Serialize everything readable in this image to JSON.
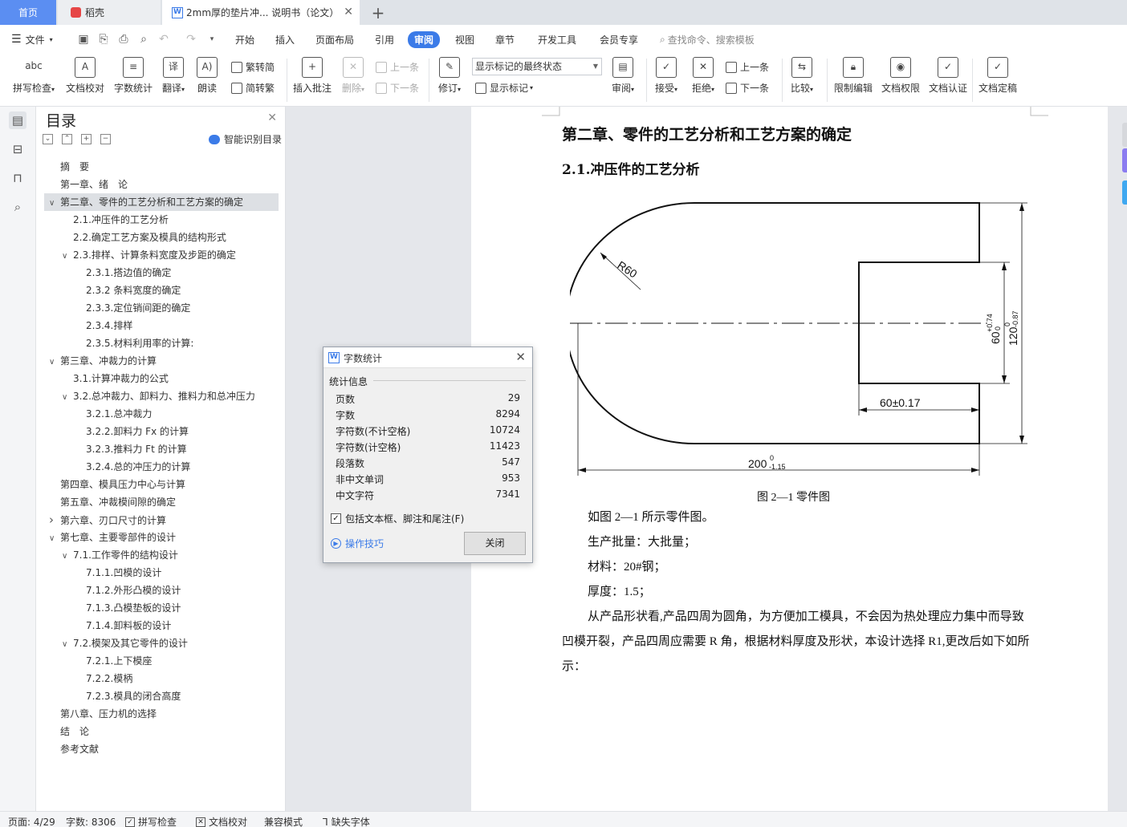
{
  "tabs": {
    "home": "首页",
    "daoke": "稻壳",
    "doc": "2mm厚的垫片冲... 说明书（论文）"
  },
  "menu": {
    "file": "文件",
    "items": [
      "开始",
      "插入",
      "页面布局",
      "引用",
      "审阅",
      "视图",
      "章节",
      "开发工具",
      "会员专享"
    ],
    "active": "审阅",
    "search_placeholder": "查找命令、搜索模板"
  },
  "ribbon": {
    "spell_check": "拼写检查",
    "doc_proof": "文档校对",
    "word_count": "字数统计",
    "translate": "翻译",
    "read_aloud": "朗读",
    "trad_to_simp_1": "繁转简",
    "simp_to_trad": "简转繁",
    "insert_comment": "插入批注",
    "delete": "删除",
    "prev_comment": "上一条",
    "next_comment": "下一条",
    "track_changes": "修订",
    "markup_combo": "显示标记的最终状态",
    "show_markup": "显示标记",
    "review": "审阅",
    "accept": "接受",
    "reject": "拒绝",
    "prev": "上一条",
    "next": "下一条",
    "compare": "比较",
    "restrict_edit": "限制编辑",
    "doc_rights": "文档权限",
    "doc_cert": "文档认证",
    "doc_final": "文档定稿"
  },
  "nav": {
    "title": "目录",
    "smart_toc": "智能识别目录",
    "items": [
      {
        "label": "摘　要",
        "level": 0,
        "caret": ""
      },
      {
        "label": "第一章、绪　论",
        "level": 0,
        "caret": ""
      },
      {
        "label": "第二章、零件的工艺分析和工艺方案的确定",
        "level": 0,
        "caret": "v"
      },
      {
        "label": "2.1.冲压件的工艺分析",
        "level": 1,
        "caret": ""
      },
      {
        "label": "2.2.确定工艺方案及模具的结构形式",
        "level": 1,
        "caret": ""
      },
      {
        "label": "2.3.排样、计算条料宽度及步距的确定",
        "level": 1,
        "caret": "v"
      },
      {
        "label": "2.3.1.搭边值的确定",
        "level": 2,
        "caret": ""
      },
      {
        "label": "2.3.2 条料宽度的确定",
        "level": 2,
        "caret": ""
      },
      {
        "label": "2.3.3.定位销间距的确定",
        "level": 2,
        "caret": ""
      },
      {
        "label": "2.3.4.排样",
        "level": 2,
        "caret": ""
      },
      {
        "label": "2.3.5.材料利用率的计算:",
        "level": 2,
        "caret": ""
      },
      {
        "label": "第三章、冲裁力的计算",
        "level": 0,
        "caret": "v"
      },
      {
        "label": "3.1.计算冲裁力的公式",
        "level": 1,
        "caret": ""
      },
      {
        "label": "3.2.总冲裁力、卸料力、推料力和总冲压力",
        "level": 1,
        "caret": "v"
      },
      {
        "label": "3.2.1.总冲裁力",
        "level": 2,
        "caret": ""
      },
      {
        "label": "3.2.2.卸料力 Fx 的计算",
        "level": 2,
        "caret": ""
      },
      {
        "label": "3.2.3.推料力 Ft 的计算",
        "level": 2,
        "caret": ""
      },
      {
        "label": "3.2.4.总的冲压力的计算",
        "level": 2,
        "caret": ""
      },
      {
        "label": "第四章、模具压力中心与计算",
        "level": 0,
        "caret": ""
      },
      {
        "label": "第五章、冲裁模间隙的确定",
        "level": 0,
        "caret": ""
      },
      {
        "label": "第六章、刃口尺寸的计算",
        "level": 0,
        "caret": ">"
      },
      {
        "label": "第七章、主要零部件的设计",
        "level": 0,
        "caret": "v"
      },
      {
        "label": "7.1.工作零件的结构设计",
        "level": 1,
        "caret": "v"
      },
      {
        "label": "7.1.1.凹模的设计",
        "level": 2,
        "caret": ""
      },
      {
        "label": "7.1.2.外形凸模的设计",
        "level": 2,
        "caret": ""
      },
      {
        "label": "7.1.3.凸模垫板的设计",
        "level": 2,
        "caret": ""
      },
      {
        "label": "7.1.4.卸料板的设计",
        "level": 2,
        "caret": ""
      },
      {
        "label": "7.2.模架及其它零件的设计",
        "level": 1,
        "caret": "v"
      },
      {
        "label": "7.2.1.上下模座",
        "level": 2,
        "caret": ""
      },
      {
        "label": "7.2.2.模柄",
        "level": 2,
        "caret": ""
      },
      {
        "label": "7.2.3.模具的闭合高度",
        "level": 2,
        "caret": ""
      },
      {
        "label": "第八章、压力机的选择",
        "level": 0,
        "caret": ""
      },
      {
        "label": "结　论",
        "level": 0,
        "caret": ""
      },
      {
        "label": "参考文献",
        "level": 0,
        "caret": ""
      }
    ],
    "selected_index": 2
  },
  "document": {
    "heading1": "第二章、零件的工艺分析和工艺方案的确定",
    "heading2": "2.1.冲压件的工艺分析",
    "drawing": {
      "radius": "R60",
      "dim_60_tol": "60±0.17",
      "dim_200": "200",
      "dim_200_upper": "0",
      "dim_200_lower": "-1.15",
      "dim_60_inner": "60",
      "dim_60_inner_upper": "+0.74",
      "dim_60_inner_lower": "0",
      "dim_120": "120",
      "dim_120_upper": "0",
      "dim_120_lower": "-0.87"
    },
    "caption": "图 2—1 零件图",
    "paragraphs": [
      "如图 2—1 所示零件图。",
      "生产批量：大批量；",
      "材料：20#钢；",
      "厚度：1.5；",
      "从产品形状看,产品四周为圆角，为方便加工模具，不会因为热处理应力集中而导致凹模开裂，产品四周应需要 R 角，根据材料厚度及形状，本设计选择 R1,更改后如下如所示："
    ]
  },
  "dialog": {
    "title": "字数统计",
    "group": "统计信息",
    "stats": [
      {
        "label": "页数",
        "value": "29"
      },
      {
        "label": "字数",
        "value": "8294"
      },
      {
        "label": "字符数(不计空格)",
        "value": "10724"
      },
      {
        "label": "字符数(计空格)",
        "value": "11423"
      },
      {
        "label": "段落数",
        "value": "547"
      },
      {
        "label": "非中文单词",
        "value": "953"
      },
      {
        "label": "中文字符",
        "value": "7341"
      }
    ],
    "include_label": "包括文本框、脚注和尾注(F)",
    "tips": "操作技巧",
    "close": "关闭"
  },
  "status": {
    "page": "页面: 4/29",
    "words": "字数: 8306",
    "spell": "拼写检查",
    "proof": "文档校对",
    "compat": "兼容模式",
    "missing_font": "缺失字体"
  },
  "colors": {
    "accent": "#3b7be8",
    "home_tab": "#5b8ef2"
  }
}
